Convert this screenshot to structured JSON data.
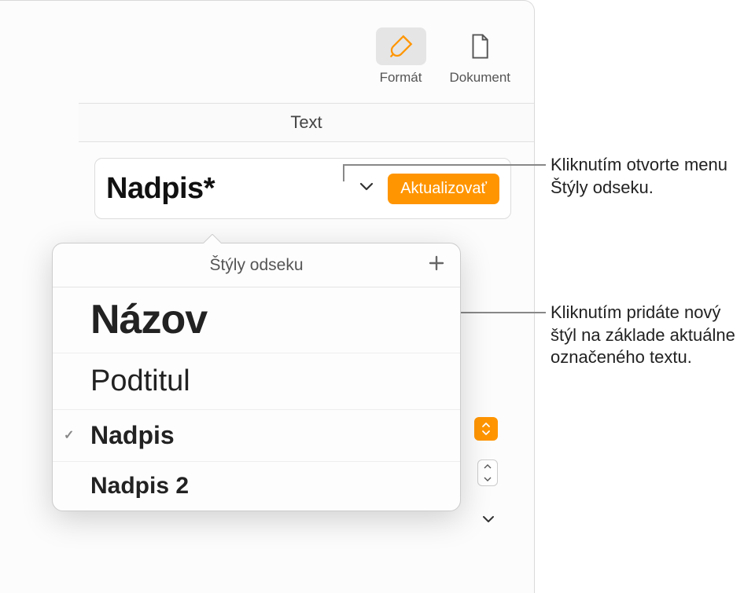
{
  "toolbar": {
    "format_label": "Formát",
    "document_label": "Dokument"
  },
  "tab": {
    "text_label": "Text"
  },
  "style_picker": {
    "current_style": "Nadpis*",
    "update_label": "Aktualizovať"
  },
  "popover": {
    "title": "Štýly odseku",
    "items": [
      {
        "label": "Názov",
        "class": "s-title",
        "checked": false
      },
      {
        "label": "Podtitul",
        "class": "s-subtitle",
        "checked": false
      },
      {
        "label": "Nadpis",
        "class": "s-heading",
        "checked": true
      },
      {
        "label": "Nadpis 2",
        "class": "s-heading2",
        "checked": false
      }
    ]
  },
  "callouts": {
    "open_menu": "Kliknutím otvorte menu Štýly odseku.",
    "add_style": "Kliknutím pridáte nový štýl na základe aktuálne označeného textu."
  }
}
